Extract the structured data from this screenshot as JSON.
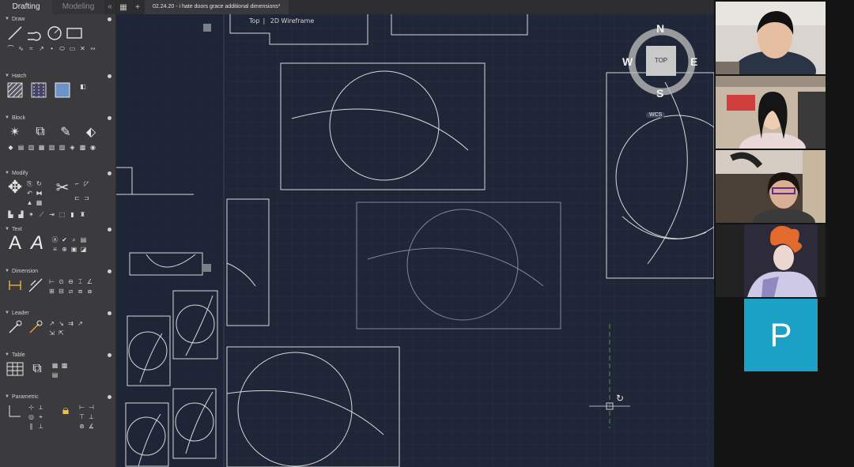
{
  "workspace_tabs": [
    "Drafting",
    "Modeling"
  ],
  "sections": [
    {
      "key": "draw",
      "label": "Draw"
    },
    {
      "key": "hatch",
      "label": "Hatch"
    },
    {
      "key": "block",
      "label": "Block"
    },
    {
      "key": "modify",
      "label": "Modify"
    },
    {
      "key": "text",
      "label": "Text"
    },
    {
      "key": "dimension",
      "label": "Dimension"
    },
    {
      "key": "leader",
      "label": "Leader"
    },
    {
      "key": "table",
      "label": "Table"
    },
    {
      "key": "parametric",
      "label": "Parametric"
    }
  ],
  "text_tool_glyph": "A",
  "doc_tab": {
    "title": "02.24.20 - i hate doors grace additional dimensions*"
  },
  "viewport": {
    "view": "Top",
    "style": "2D Wireframe"
  },
  "viewcube": {
    "north": "N",
    "south": "S",
    "east": "E",
    "west": "W",
    "face": "TOP"
  },
  "wcs_badge": "WCS",
  "colors": {
    "canvas_bg": "#1f2637",
    "palette_bg": "#3b3b3d",
    "participant_tile": "#1ba1c5"
  },
  "participants": [
    {
      "type": "video",
      "icon": "webcam-person"
    },
    {
      "type": "video",
      "icon": "webcam-person"
    },
    {
      "type": "video",
      "icon": "webcam-person"
    },
    {
      "type": "avatar-image",
      "icon": "anime-avatar"
    },
    {
      "type": "initial",
      "initial": "P"
    }
  ]
}
